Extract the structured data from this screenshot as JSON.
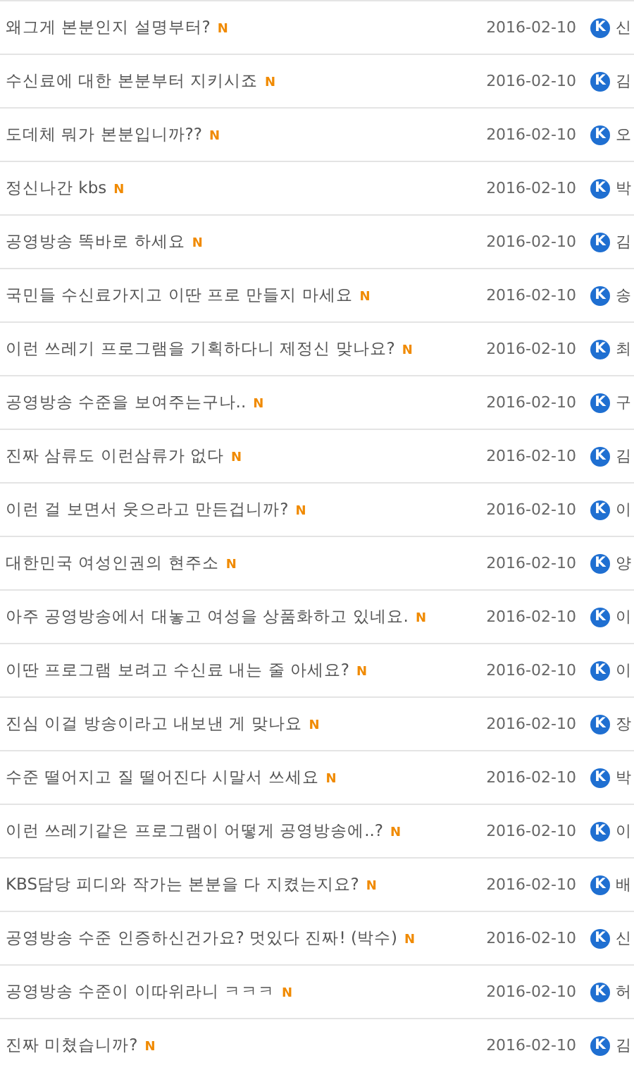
{
  "rows": [
    {
      "title": "왜그게 본분인지 설명부터?",
      "new_mark": "N",
      "date": "2016-02-10",
      "badge": "K",
      "author": "신"
    },
    {
      "title": "수신료에 대한 본분부터 지키시죠",
      "new_mark": "N",
      "date": "2016-02-10",
      "badge": "K",
      "author": "김"
    },
    {
      "title": "도데체 뭐가 본분입니까??",
      "new_mark": "N",
      "date": "2016-02-10",
      "badge": "K",
      "author": "오"
    },
    {
      "title": "정신나간 kbs",
      "new_mark": "N",
      "date": "2016-02-10",
      "badge": "K",
      "author": "박"
    },
    {
      "title": "공영방송 똑바로 하세요",
      "new_mark": "N",
      "date": "2016-02-10",
      "badge": "K",
      "author": "김"
    },
    {
      "title": "국민들 수신료가지고 이딴 프로 만들지 마세요",
      "new_mark": "N",
      "date": "2016-02-10",
      "badge": "K",
      "author": "송"
    },
    {
      "title": "이런 쓰레기 프로그램을 기획하다니 제정신 맞나요?",
      "new_mark": "N",
      "date": "2016-02-10",
      "badge": "K",
      "author": "최"
    },
    {
      "title": "공영방송 수준을 보여주는구나..",
      "new_mark": "N",
      "date": "2016-02-10",
      "badge": "K",
      "author": "구"
    },
    {
      "title": "진짜 삼류도 이런삼류가 없다",
      "new_mark": "N",
      "date": "2016-02-10",
      "badge": "K",
      "author": "김"
    },
    {
      "title": "이런 걸 보면서 웃으라고 만든겁니까?",
      "new_mark": "N",
      "date": "2016-02-10",
      "badge": "K",
      "author": "이"
    },
    {
      "title": "대한민국 여성인권의 현주소",
      "new_mark": "N",
      "date": "2016-02-10",
      "badge": "K",
      "author": "양"
    },
    {
      "title": "아주 공영방송에서 대놓고 여성을 상품화하고 있네요.",
      "new_mark": "N",
      "date": "2016-02-10",
      "badge": "K",
      "author": "이"
    },
    {
      "title": "이딴 프로그램 보려고 수신료 내는 줄 아세요?",
      "new_mark": "N",
      "date": "2016-02-10",
      "badge": "K",
      "author": "이"
    },
    {
      "title": "진심 이걸 방송이라고 내보낸 게 맞나요",
      "new_mark": "N",
      "date": "2016-02-10",
      "badge": "K",
      "author": "장"
    },
    {
      "title": "수준 떨어지고 질 떨어진다 시말서 쓰세요",
      "new_mark": "N",
      "date": "2016-02-10",
      "badge": "K",
      "author": "박"
    },
    {
      "title": "이런 쓰레기같은 프로그램이 어떻게 공영방송에..?",
      "new_mark": "N",
      "date": "2016-02-10",
      "badge": "K",
      "author": "이"
    },
    {
      "title": "KBS담당 피디와 작가는 본분을 다 지켰는지요?",
      "new_mark": "N",
      "date": "2016-02-10",
      "badge": "K",
      "author": "배"
    },
    {
      "title": "공영방송 수준 인증하신건가요? 멋있다 진짜! (박수)",
      "new_mark": "N",
      "date": "2016-02-10",
      "badge": "K",
      "author": "신"
    },
    {
      "title": "공영방송 수준이 이따위라니 ㅋㅋㅋ",
      "new_mark": "N",
      "date": "2016-02-10",
      "badge": "K",
      "author": "허"
    },
    {
      "title": "진짜 미쳤습니까?",
      "new_mark": "N",
      "date": "2016-02-10",
      "badge": "K",
      "author": "김"
    }
  ]
}
